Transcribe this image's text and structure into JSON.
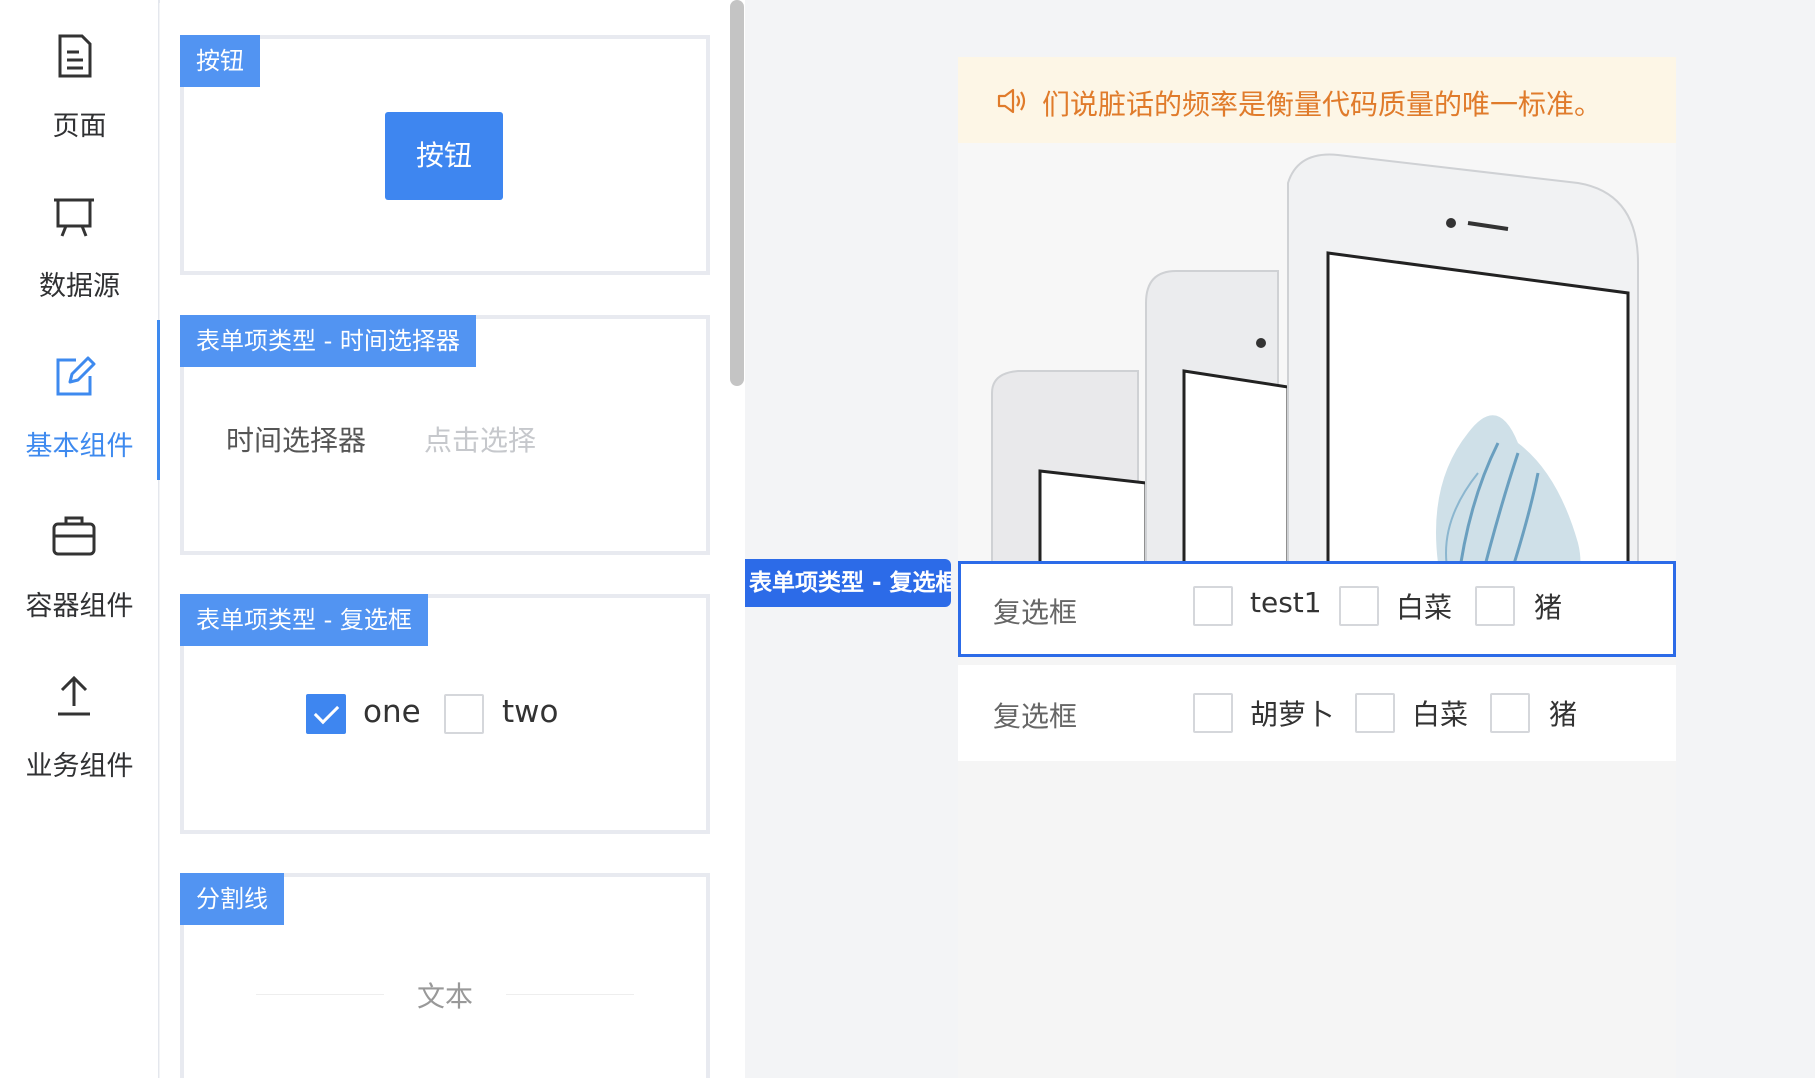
{
  "nav": {
    "items": [
      {
        "label": "页面",
        "icon": "page-icon"
      },
      {
        "label": "数据源",
        "icon": "presentation-board-icon"
      },
      {
        "label": "基本组件",
        "icon": "edit-icon",
        "active": true
      },
      {
        "label": "容器组件",
        "icon": "briefcase-icon"
      },
      {
        "label": "业务组件",
        "icon": "upload-icon"
      }
    ],
    "active_color": "#3e8aef"
  },
  "panel": {
    "cards": [
      {
        "tag": "按钮",
        "button_label": "按钮"
      },
      {
        "tag": "表单项类型 - 时间选择器",
        "label": "时间选择器",
        "placeholder": "点击选择"
      },
      {
        "tag": "表单项类型 - 复选框",
        "options": [
          {
            "label": "one",
            "checked": true
          },
          {
            "label": "two",
            "checked": false
          }
        ]
      },
      {
        "tag": "分割线",
        "text": "文本"
      }
    ]
  },
  "preview": {
    "notice": {
      "icon": "speaker-icon",
      "text": "们说脏话的频率是衡量代码质量的唯一标准。"
    },
    "banner": {
      "image": "iphone-product-photo",
      "indicator_count": 1
    },
    "drag_tag": "表单项类型 - 复选框",
    "rows": [
      {
        "label": "复选框",
        "selected": true,
        "options": [
          "test1",
          "白菜",
          "猪"
        ]
      },
      {
        "label": "复选框",
        "selected": false,
        "options": [
          "胡萝卜",
          "白菜",
          "猪"
        ]
      }
    ]
  },
  "colors": {
    "primary": "#3e86f0",
    "tag_bg": "#5294f2",
    "notice_text": "#e07b2b",
    "notice_bg": "#fdf6e6",
    "selected_border": "#2c6be8"
  }
}
